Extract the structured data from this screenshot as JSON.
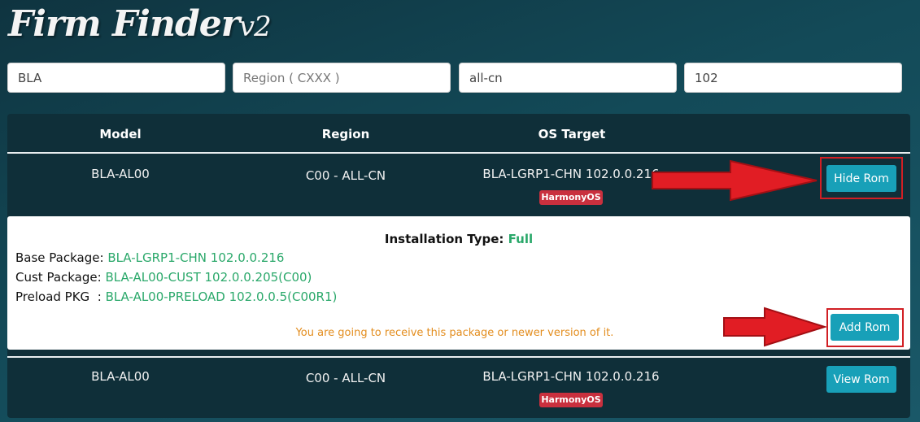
{
  "app": {
    "logo_main": "Firm Finder",
    "logo_version": "v2"
  },
  "search": {
    "model_value": "BLA",
    "region_placeholder": "Region ( CXXX )",
    "ostarget_value": "all-cn",
    "version_value": "102"
  },
  "table": {
    "headers": {
      "model": "Model",
      "region": "Region",
      "os_target": "OS Target"
    },
    "rows": [
      {
        "model": "BLA-AL00",
        "region": "C00 - ALL-CN",
        "os_target": "BLA-LGRP1-CHN 102.0.0.216",
        "badge": "HarmonyOS",
        "button": "Hide Rom"
      },
      {
        "model": "BLA-AL00",
        "region": "C00 - ALL-CN",
        "os_target": "BLA-LGRP1-CHN 102.0.0.216",
        "badge": "HarmonyOS",
        "button": "View Rom"
      }
    ]
  },
  "detail": {
    "installation_label": "Installation Type:",
    "installation_value": "Full",
    "base_label": "Base Package:",
    "base_value": "BLA-LGRP1-CHN 102.0.0.216",
    "cust_label": "Cust Package:",
    "cust_value": "BLA-AL00-CUST 102.0.0.205(C00)",
    "preload_label": "Preload PKG  :",
    "preload_value": "BLA-AL00-PRELOAD 102.0.0.5(C00R1)",
    "note": "You are going to receive this package or newer version of it.",
    "add_button": "Add Rom"
  },
  "colors": {
    "accent_button": "#18a0b8",
    "badge": "#c9303e",
    "highlight": "#d11f24",
    "package_green": "#2aa86a",
    "note_orange": "#e38d1e"
  }
}
